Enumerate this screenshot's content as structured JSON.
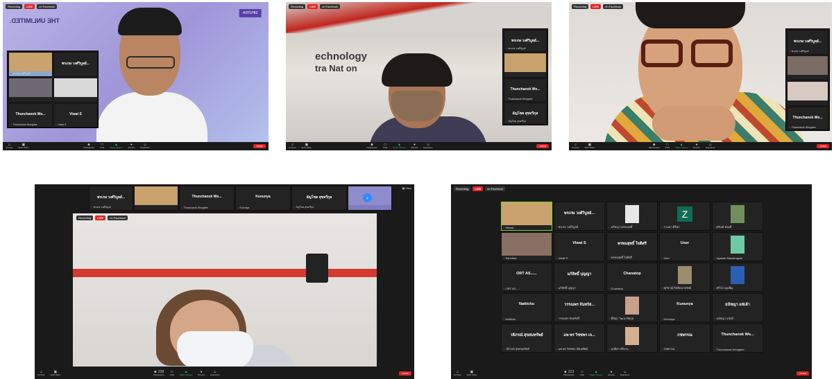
{
  "toolbar": {
    "unmute": "Unmute",
    "start_video": "Start Video",
    "participants": "Participants",
    "chat": "Chat",
    "share_screen": "Share Screen",
    "record": "Record",
    "reactions": "Reactions",
    "leave": "Leave"
  },
  "status": {
    "recording": "Recording",
    "live": "LIVE",
    "on_facebook": "on Facebook",
    "view": "View"
  },
  "shot1": {
    "banner": "THE UNLIMITED.",
    "logo": "SIPUTRA",
    "tiles": [
      {
        "name": "พรเกษ วงศ์วิบูลย์...",
        "label": "พรเกษ วงศ์วิบูลย์"
      },
      {
        "name": "Thunchanok Wo...",
        "label": "Thunchanok Wongdee"
      },
      {
        "name": "Viwat S",
        "label": "Viwat S"
      }
    ]
  },
  "shot2": {
    "wall_text_1": "echnology",
    "wall_text_2": "tra Nat on",
    "tiles": [
      {
        "name": "พรเกษ วงศ์วิบูลย์...",
        "label": "พรเกษ วงศ์วิบูลย์"
      },
      {
        "name": "Thunchanok Wo...",
        "label": "Thunchanok Wongdee"
      },
      {
        "name": "อัญโชค สุขทวีกุล",
        "label": "อัญโชค สุขทวีกุล"
      }
    ]
  },
  "shot3": {
    "tiles": [
      {
        "name": "พรเกษ วงศ์วิบูลย์...",
        "label": "พรเกษ วงศ์วิบูลย์"
      },
      {
        "name": "Thunchanok Wo...",
        "label": "Thunchanok Wongdee"
      }
    ]
  },
  "shot4": {
    "participant_count": "238",
    "strip": [
      {
        "name": "พรเกษ วงศ์วิบูลย์...",
        "label": "พรเกษ วงศ์วิบูลย์"
      },
      {
        "name": "Thunchanok Wo...",
        "label": "Thunchanok Wongdee"
      },
      {
        "name": "Kununya",
        "label": "Kununya"
      },
      {
        "name": "อัญโชค สุขทวีกุล",
        "label": "อัญโชค สุขทวีกุล"
      }
    ]
  },
  "shot5": {
    "participant_count": "223",
    "tiles": [
      {
        "name": "",
        "label": "Sirisak",
        "kind": "cam"
      },
      {
        "name": "พรเกษ วงศ์วิบูลย์...",
        "label": "พรเกษ วงศ์วิบูลย์"
      },
      {
        "name": "",
        "label": "อภิชญา เตชะฤทธิ์",
        "kind": "avatar"
      },
      {
        "name": "Z",
        "label": "กานดา ศิริพร",
        "kind": "z"
      },
      {
        "name": "",
        "label": "ศรัณย์ พรมดี",
        "kind": "photo"
      },
      {
        "name": "",
        "label": "Samribut",
        "kind": "cam2"
      },
      {
        "name": "Viwat S",
        "label": "Viwat S"
      },
      {
        "name": "พรพนสุทธิ์ ใจดีศรี",
        "label": "พรพนสุทธิ์ ใจดีศรี"
      },
      {
        "name": "User",
        "label": "User"
      },
      {
        "name": "",
        "label": "Ugasan Sawaengsak",
        "kind": "anime"
      },
      {
        "name": "ORT AS......",
        "label": "ORT AS......"
      },
      {
        "name": "แก้ลิทธิ์ บุญญา",
        "label": "แก้ลิทธิ์ บุญญา"
      },
      {
        "name": "Chanatop",
        "label": "Chanatop"
      },
      {
        "name": "",
        "label": "ศุภิชาญ์ กิตติธนาทรัพย์",
        "kind": "landscape"
      },
      {
        "name": "",
        "label": "ศรีโต บุญเพ็ญ",
        "kind": "blue"
      },
      {
        "name": "Nattichu",
        "label": "Nattichu"
      },
      {
        "name": "วรรณพร จันทร์ส...",
        "label": "วรรณพร จันทร์ศรี"
      },
      {
        "name": "",
        "label": "ดีปิญา วัฒนาชัยกุล",
        "kind": "selfie"
      },
      {
        "name": "Kununya",
        "label": "Kununya"
      },
      {
        "name": "ธนัชญา แซ่เล้า",
        "label": "ธนัชญา แซ่เล้า"
      },
      {
        "name": "วลีภรณ์ สุขสมทรัพย์",
        "label": "วลีภรณ์ สุขสมทรัพย์"
      },
      {
        "name": "แพ พร วิชชพร เจ...",
        "label": "แพ พร วิชชพร เจียนศัพท์"
      },
      {
        "name": "",
        "label": "มนัสิดา ศิริงาม",
        "kind": "selfie2"
      },
      {
        "name": "กชพรรณ",
        "label": "กชพรรณ"
      },
      {
        "name": "Thunchanok Wo...",
        "label": "Thunchanok Wongdee"
      }
    ]
  }
}
